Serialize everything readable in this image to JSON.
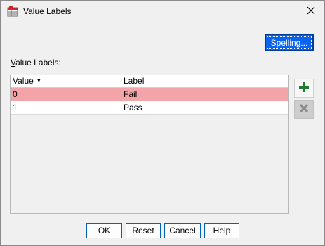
{
  "window": {
    "title": "Value Labels"
  },
  "toolbar": {
    "spelling_label": "Spelling..."
  },
  "section": {
    "prefix": "V",
    "rest": "alue Labels:"
  },
  "table": {
    "columns": [
      {
        "label": "Value"
      },
      {
        "label": "Label"
      }
    ],
    "rows": [
      {
        "value": "0",
        "label": "Fail"
      },
      {
        "value": "1",
        "label": "Pass"
      }
    ]
  },
  "footer": {
    "ok_label": "OK",
    "reset_label": "Reset",
    "cancel_label": "Cancel",
    "help_label": "Help"
  },
  "colors": {
    "selected_row": "#f2a4a8",
    "primary_button": "#0a64f0",
    "add_icon": "#1f7a33",
    "remove_icon": "#8a8a8a"
  },
  "icons": {
    "title": "value-labels-icon",
    "close": "close-icon",
    "add": "plus-icon",
    "remove": "x-icon",
    "sort": "sort-down-icon"
  }
}
